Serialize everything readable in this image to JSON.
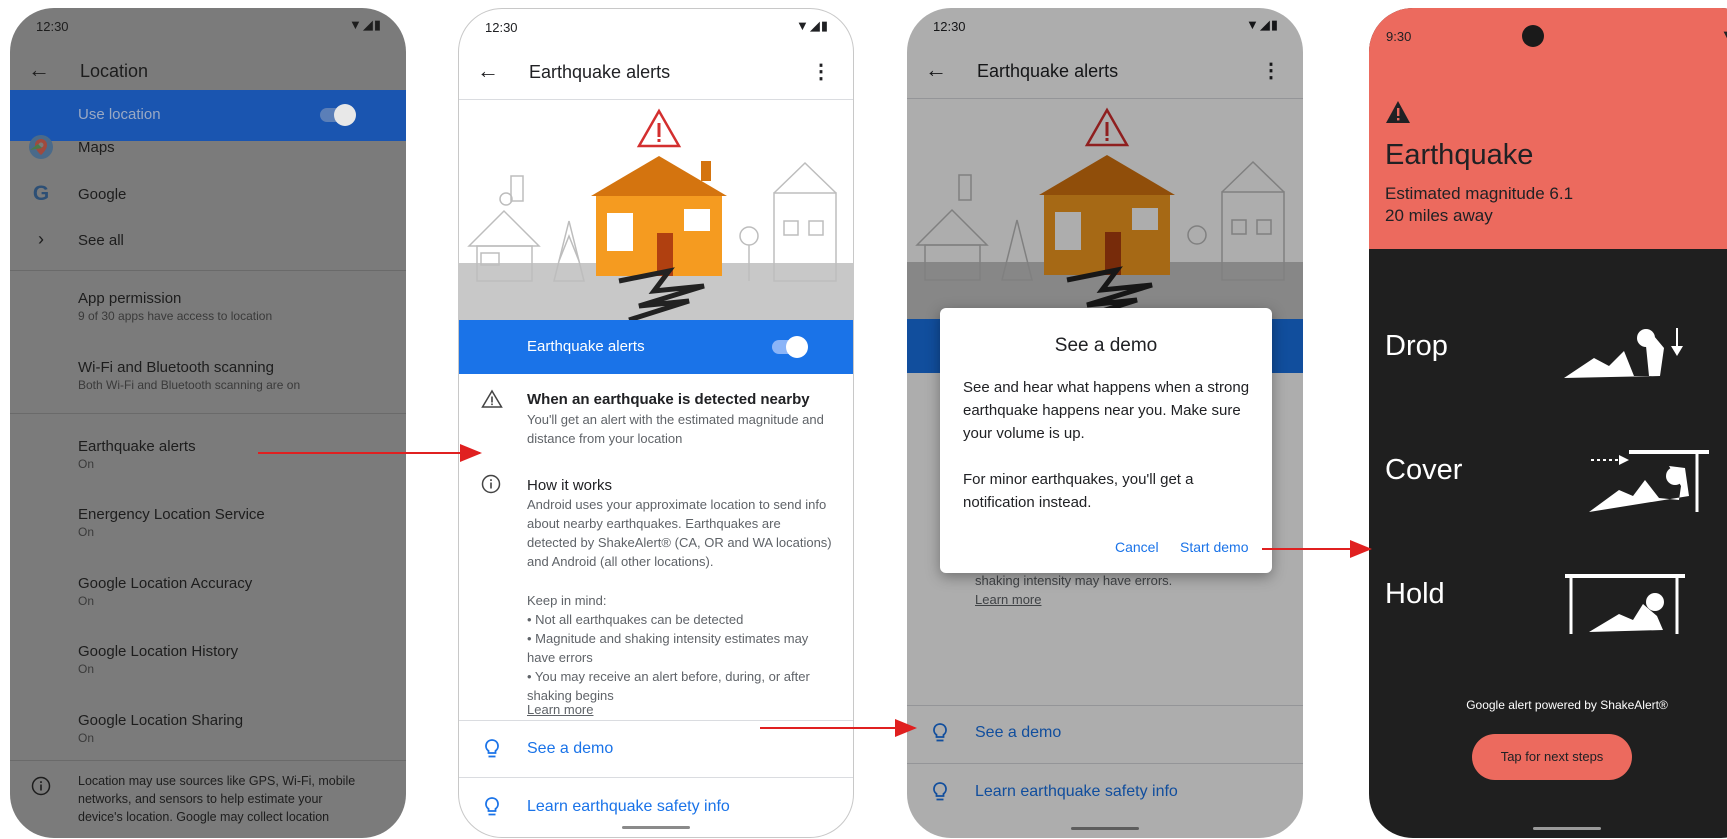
{
  "phone1": {
    "time": "12:30",
    "status_icons": "▼◢▮",
    "title": "Location",
    "use_location": "Use location",
    "items": [
      {
        "title": "Maps",
        "subtitle": ""
      },
      {
        "title": "Google",
        "subtitle": ""
      },
      {
        "title": "See all",
        "subtitle": ""
      },
      {
        "title": "App permission",
        "subtitle": "9 of 30 apps have access to location"
      },
      {
        "title": "Wi-Fi and Bluetooth scanning",
        "subtitle": "Both Wi-Fi and Bluetooth scanning are on"
      },
      {
        "title": "Earthquake alerts",
        "subtitle": "On"
      },
      {
        "title": "Energency Location Service",
        "subtitle": "On"
      },
      {
        "title": "Google Location Accuracy",
        "subtitle": "On"
      },
      {
        "title": "Google Location History",
        "subtitle": "On"
      },
      {
        "title": "Google Location Sharing",
        "subtitle": "On"
      }
    ],
    "footer_lines": [
      "Location may use sources like GPS, Wi-Fi, mobile",
      "networks, and sensors to help estimate your",
      "device's location. Google may collect location"
    ]
  },
  "phone2": {
    "time": "12:30",
    "status_icons": "▼◢▮",
    "title": "Earthquake alerts",
    "toggle_label": "Earthquake alerts",
    "detected_heading": "When an earthquake is detected nearby",
    "detected_body": "You'll get an alert with the estimated magnitude and distance from your location",
    "how_heading": "How it works",
    "how_body": "Android uses your approximate location to send info about nearby earthquakes. Earthquakes are detected by ShakeAlert® (CA, OR and WA locations) and Android (all other locations).",
    "keep_in_mind": "Keep in mind:",
    "bullets": [
      "• Not all earthquakes can be detected",
      "• Magnitude and shaking intensity estimates may have errors",
      "• You may receive an alert before, during, or after shaking begins"
    ],
    "learn_more": "Learn more",
    "see_demo": "See a demo",
    "safety_info": "Learn earthquake safety info"
  },
  "phone3": {
    "time": "12:30",
    "status_icons": "▼◢▮",
    "title": "Earthquake alerts",
    "dialog_title": "See a demo",
    "dialog_body1": "See and hear what happens when a strong earthquake happens near you. Make sure your volume is up.",
    "dialog_body2": "For minor earthquakes, you'll get a notification instead.",
    "cancel": "Cancel",
    "start_demo": "Start demo",
    "behind_text": "shaking intensity may have errors.",
    "learn_more": "Learn more",
    "see_demo": "See a demo",
    "safety_info": "Learn earthquake safety info"
  },
  "phone4": {
    "time": "9:30",
    "status_icons": "▼◢▮",
    "heading": "Earthquake",
    "magnitude": "Estimated magnitude 6.1",
    "distance": "20 miles away",
    "steps": [
      "Drop",
      "Cover",
      "Hold"
    ],
    "powered_by": "Google alert powered by ShakeAlert®",
    "next_button": "Tap for next steps"
  },
  "colors": {
    "accent": "#1a73e8",
    "alert": "#ec6a5e",
    "arrow": "#e02020"
  }
}
